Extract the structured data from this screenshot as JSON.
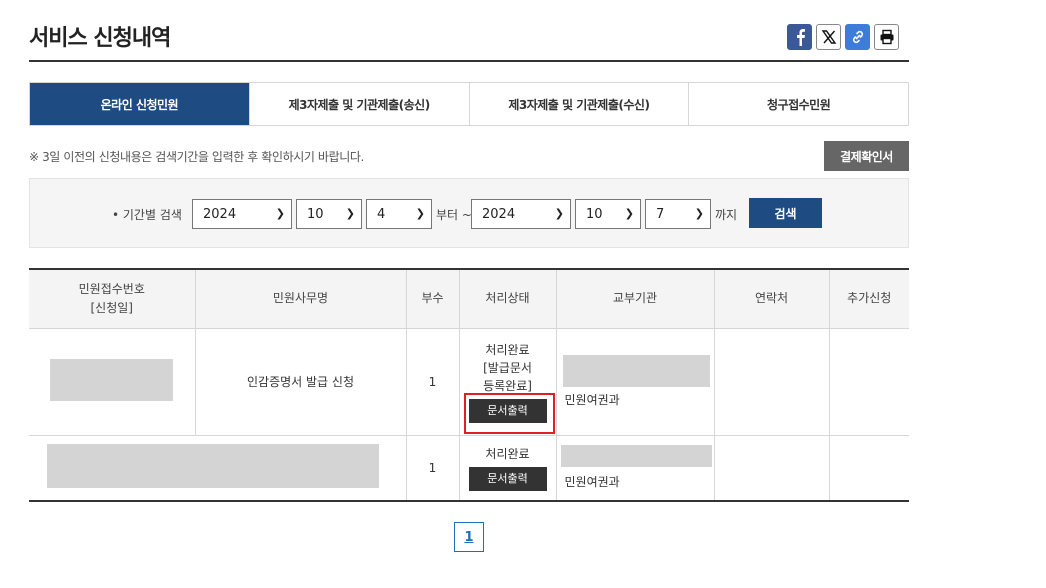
{
  "page": {
    "title": "서비스 신청내역"
  },
  "share": {
    "facebook": "facebook-icon",
    "x": "x-icon",
    "link": "link-icon",
    "print": "print-icon"
  },
  "tabs": [
    {
      "label": "온라인 신청민원",
      "active": true
    },
    {
      "label": "제3자제출 및 기관제출(송신)",
      "active": false
    },
    {
      "label": "제3자제출 및 기관제출(수신)",
      "active": false
    },
    {
      "label": "청구접수민원",
      "active": false
    }
  ],
  "notice": "※ 3일 이전의 신청내용은 검색기간을 입력한 후 확인하시기 바랍니다.",
  "confirm_button": "결제확인서",
  "search": {
    "label": "• 기간별 검색",
    "from_year": "2024",
    "from_month": "10",
    "from_day": "4",
    "from_suffix": "부터 ~",
    "to_year": "2024",
    "to_month": "10",
    "to_day": "7",
    "to_suffix": "까지",
    "button": "검색"
  },
  "table": {
    "headers": [
      "민원접수번호",
      "[신청일]",
      "민원사무명",
      "부수",
      "처리상태",
      "교부기관",
      "연락처",
      "추가신청"
    ],
    "rows": [
      {
        "service": "인감증명서 발급 신청",
        "copies": "1",
        "status_lines": [
          "처리완료",
          "[발급문서",
          "등록완료]"
        ],
        "print_label": "문서출력",
        "agency": "민원여권과"
      },
      {
        "service": "",
        "copies": "1",
        "status_lines": [
          "처리완료"
        ],
        "print_label": "문서출력",
        "agency": "민원여권과"
      }
    ]
  },
  "pagination": {
    "current": "1"
  },
  "colors": {
    "primary": "#1e4b82",
    "highlight": "#e02020"
  }
}
